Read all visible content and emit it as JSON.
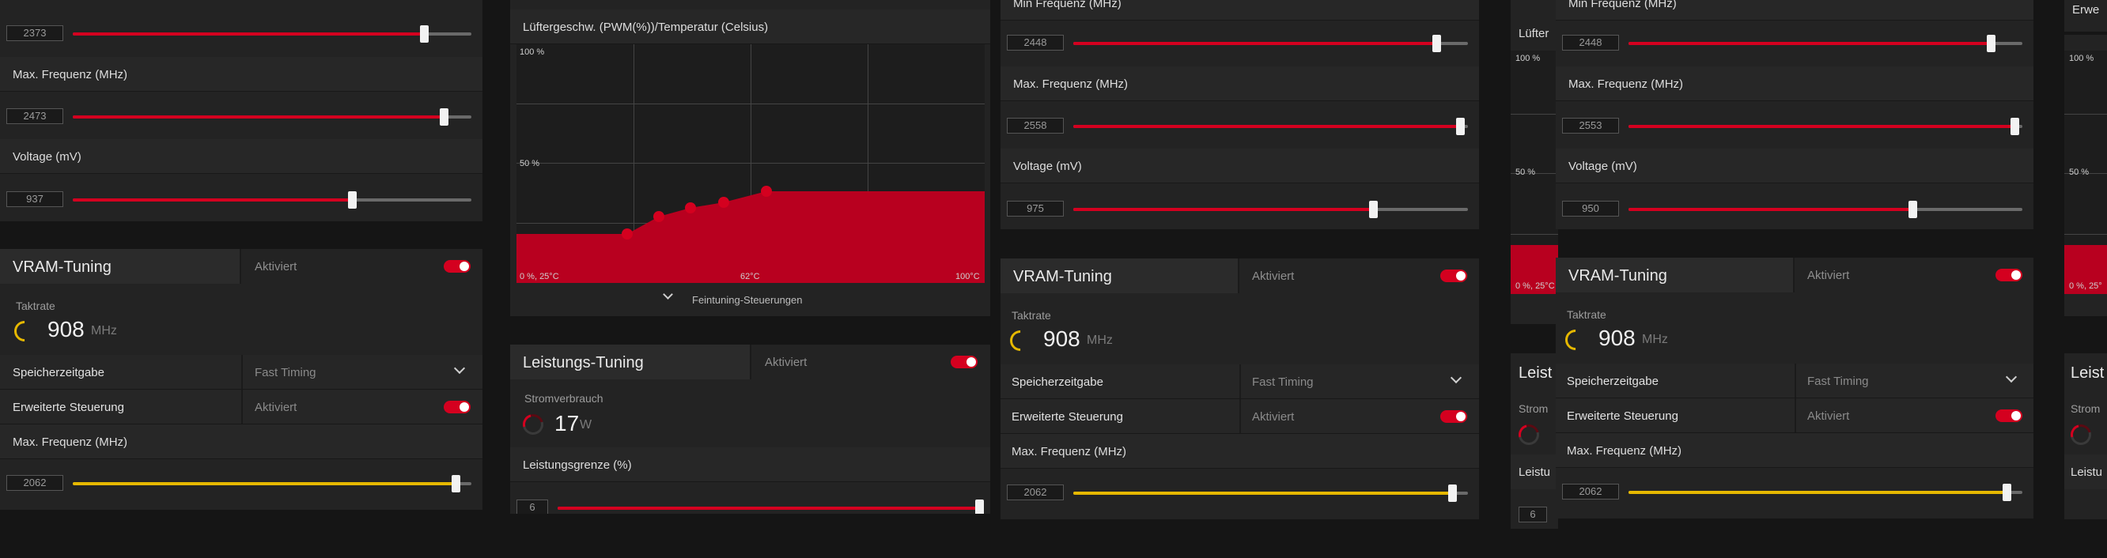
{
  "colors": {
    "accent_red": "#d4001f",
    "accent_yellow": "#e6b800",
    "panel_bg": "#232323"
  },
  "p1": {
    "gpu": {
      "first_slider": {
        "value": "2373",
        "level": 0.88
      },
      "max_freq": {
        "label": "Max. Frequenz (MHz)",
        "value": "2473",
        "level": 0.93
      },
      "voltage": {
        "label": "Voltage (mV)",
        "value": "937",
        "level": 0.7
      }
    },
    "vram": {
      "title": "VRAM-Tuning",
      "status": "Aktiviert",
      "clock_label": "Taktrate",
      "clock_value": "908",
      "clock_unit": "MHz",
      "timing_label": "Speicherzeitgabe",
      "timing_value": "Fast Timing",
      "adv_label": "Erweiterte Steuerung",
      "adv_value": "Aktiviert",
      "max_freq": {
        "label": "Max. Frequenz (MHz)",
        "value": "2062",
        "level": 0.96
      }
    }
  },
  "p2": {
    "fan": {
      "title": "Lüftergeschw. (PWM(%))/Temperatur (Celsius)",
      "y_top": "100 %",
      "y_mid": "50 %",
      "x_left": "0 %, 25°C",
      "x_mid": "62°C",
      "x_right": "100°C",
      "fine_tune": "Feintuning-Steuerungen"
    },
    "power": {
      "title": "Leistungs-Tuning",
      "status": "Aktiviert",
      "consumption_label": "Stromverbrauch",
      "consumption_value": "17",
      "consumption_unit": "W",
      "limit": {
        "label": "Leistungsgrenze (%)",
        "value": "6",
        "level": 1.0
      }
    }
  },
  "p3": {
    "gpu": {
      "min_freq": {
        "label": "Min Frequenz (MHz)",
        "value": "2448",
        "level": 0.92
      },
      "max_freq": {
        "label": "Max. Frequenz (MHz)",
        "value": "2558",
        "level": 0.98
      },
      "voltage": {
        "label": "Voltage (mV)",
        "value": "975",
        "level": 0.76
      }
    },
    "vram": {
      "title": "VRAM-Tuning",
      "status": "Aktiviert",
      "clock_label": "Taktrate",
      "clock_value": "908",
      "clock_unit": "MHz",
      "timing_label": "Speicherzeitgabe",
      "timing_value": "Fast Timing",
      "adv_label": "Erweiterte Steuerung",
      "adv_value": "Aktiviert",
      "max_freq": {
        "label": "Max. Frequenz (MHz)",
        "value": "2062",
        "level": 0.96
      }
    }
  },
  "p4": {
    "fan": {
      "title": "Lüfter",
      "y_top": "100 %",
      "y_mid": "50 %",
      "x_left": "0 %, 25°C"
    },
    "power": {
      "title": "Leist",
      "consumption_label": "Strom",
      "limit_label": "Leistu",
      "limit_value": "6"
    }
  },
  "p5": {
    "gpu": {
      "min_freq": {
        "label": "Min Frequenz (MHz)",
        "value": "2448",
        "level": 0.92
      },
      "max_freq": {
        "label": "Max. Frequenz (MHz)",
        "value": "2553",
        "level": 0.98
      },
      "voltage": {
        "label": "Voltage (mV)",
        "value": "950",
        "level": 0.72
      }
    },
    "vram": {
      "title": "VRAM-Tuning",
      "status": "Aktiviert",
      "clock_label": "Taktrate",
      "clock_value": "908",
      "clock_unit": "MHz",
      "timing_label": "Speicherzeitgabe",
      "timing_value": "Fast Timing",
      "adv_label": "Erweiterte Steuerung",
      "adv_value": "Aktiviert",
      "max_freq": {
        "label": "Max. Frequenz (MHz)",
        "value": "2062",
        "level": 0.96
      }
    }
  },
  "p6": {
    "gpu": {
      "top_label": "Erwe"
    },
    "fan": {
      "y_top": "100 %",
      "y_mid": "50 %",
      "x_left": "0 %, 25°"
    },
    "power": {
      "title": "Leist",
      "consumption_label": "Strom",
      "limit_label": "Leistu"
    }
  }
}
